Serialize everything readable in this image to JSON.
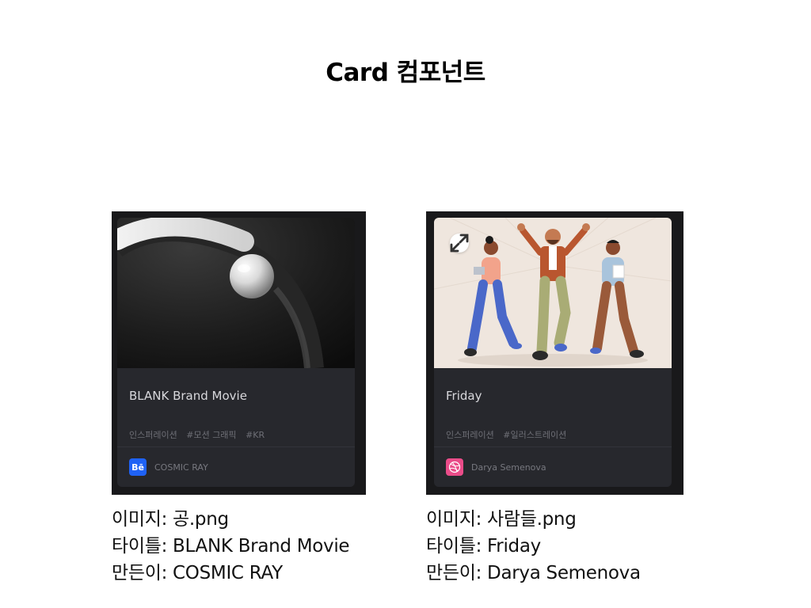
{
  "page": {
    "title": "Card 컴포넌트"
  },
  "cards": [
    {
      "title": "BLANK Brand Movie",
      "tags": [
        "인스퍼레이션",
        "#모션 그래픽",
        "#KR"
      ],
      "source_icon": "behance-icon",
      "source_icon_label": "Bē",
      "author": "COSMIC RAY",
      "info": {
        "image": "이미지: 공.png",
        "title": "타이틀: BLANK Brand Movie",
        "author": "만든이: COSMIC RAY"
      }
    },
    {
      "title": "Friday",
      "tags": [
        "인스퍼레이션",
        "#일러스트레이션"
      ],
      "source_icon": "dribbble-icon",
      "author": "Darya Semenova",
      "info": {
        "image": "이미지: 사람들.png",
        "title": "타이틀: Friday",
        "author": "만든이: Darya Semenova"
      }
    }
  ],
  "colors": {
    "card_bg": "#27282d",
    "frame_bg": "#19191b",
    "behance": "#1f62f5",
    "dribbble": "#ea4c89"
  }
}
